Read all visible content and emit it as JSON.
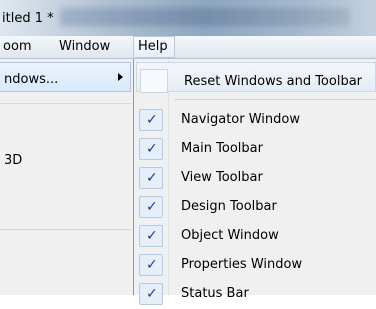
{
  "window": {
    "title": "itled 1 *"
  },
  "menubar": {
    "items": [
      "oom",
      "Window",
      "Help"
    ]
  },
  "window_menu": {
    "items": [
      {
        "label": "ndows...",
        "has_submenu": true
      },
      {
        "label": "3D"
      }
    ]
  },
  "submenu": {
    "reset_label": "Reset Windows and Toolbar",
    "items": [
      {
        "label": "Navigator Window",
        "checked": true
      },
      {
        "label": "Main Toolbar",
        "checked": true
      },
      {
        "label": "View Toolbar",
        "checked": true
      },
      {
        "label": "Design Toolbar",
        "checked": true
      },
      {
        "label": "Object Window",
        "checked": true
      },
      {
        "label": "Properties Window",
        "checked": true
      },
      {
        "label": "Status Bar",
        "checked": true
      }
    ]
  },
  "icons": {
    "check": "check-icon",
    "submenu_arrow": "chevron-right-icon"
  },
  "colors": {
    "check": "#1a3f8f",
    "highlight_border": "#a8c8ec"
  }
}
